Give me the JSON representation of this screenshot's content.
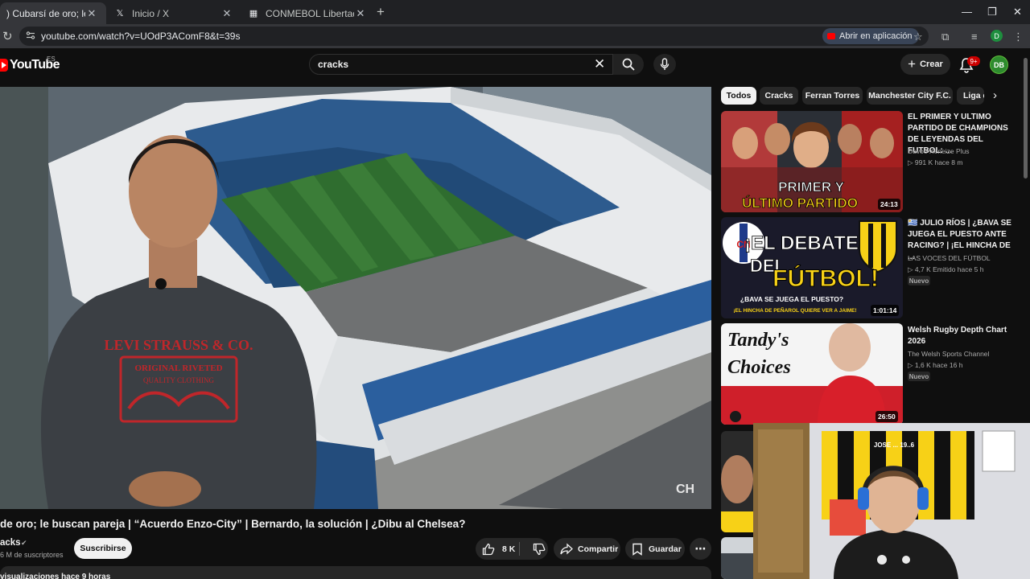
{
  "browser": {
    "tabs": [
      {
        "title": ") Cubarsí de oro; le buscan p",
        "active": true,
        "favicon": "youtube-icon"
      },
      {
        "title": "Inicio / X",
        "active": false,
        "favicon": "x-icon"
      },
      {
        "title": "CONMEBOL Libertadores - Tabl",
        "active": false,
        "favicon": "conmebol-icon"
      }
    ],
    "new_tab": "+",
    "url": "youtube.com/watch?v=UOdP3AComF8&t=39s",
    "open_app_label": "Abrir en aplicación",
    "profile_initial": "D"
  },
  "youtube": {
    "logo_text": "YouTube",
    "region": "ES",
    "search_value": "cracks",
    "create_label": "Crear",
    "notification_count": "9+",
    "avatar_initials": "DB"
  },
  "video": {
    "title": "de oro; le buscan pareja | “Acuerdo Enzo-City” | Bernardo, la solución | ¿Dibu al Chelsea?",
    "channel": "acks",
    "subscribers": "6 M de suscriptores",
    "subscribe_label": "Suscribirse",
    "likes": "8 K",
    "share_label": "Compartir",
    "save_label": "Guardar",
    "stats": "visualizaciones  hace 9 horas",
    "watermark": "CH",
    "shirt_text": "LEVI STRAUSS & CO.",
    "shirt_text2": "ORIGINAL RIVETED",
    "shirt_text3": "QUALITY   CLOTHING"
  },
  "chips": [
    "Todos",
    "Cracks",
    "Ferran Torres",
    "Manchester City F.C.",
    "Liga de"
  ],
  "recommendations": [
    {
      "title": "EL PRIMER Y ULTIMO PARTIDO DE CHAMPIONS DE LEYENDAS DEL FUTBOL: ...",
      "channel": "Davoo Xeneize Plus",
      "meta": "▷ 991 K   hace 8 m",
      "duration": "24:13",
      "thumb_text1": "PRIMER Y",
      "thumb_text2": "ÚLTIMO PARTIDO",
      "badge": ""
    },
    {
      "title": "🇺🇾 JULIO RÍOS | ¿BAVA SE JUEGA EL PUESTO ANTE RACING? | ¡EL HINCHA DE ...",
      "channel": "LAS VOCES DEL FÚTBOL",
      "meta": "▷ 4,7 K   Emitido hace 5 h",
      "duration": "1:01:14",
      "thumb_text1": "¡EL DEBATE",
      "thumb_text2": "DEL",
      "thumb_text3": "FÚTBOL!",
      "thumb_text4": "¿BAVA SE JUEGA EL PUESTO?",
      "thumb_text5": "¡EL HINCHA DE PEÑAROL QUIERE VER A JAIME!",
      "badge": "Nuevo"
    },
    {
      "title": "Welsh Rugby Depth Chart 2026",
      "channel": "The Welsh Sports Channel",
      "meta": "▷ 1,6 K   hace 16 h",
      "duration": "26:50",
      "thumb_text1": "Tandy's",
      "thumb_text2": "Choices",
      "badge": "Nuevo"
    }
  ],
  "webcam": {
    "flag_text": "JOSE ... 19..6"
  },
  "colors": {
    "background": "#0f0f0f",
    "chip": "#272727",
    "yt_red": "#ff0000",
    "accent_yellow": "#f7d117"
  }
}
